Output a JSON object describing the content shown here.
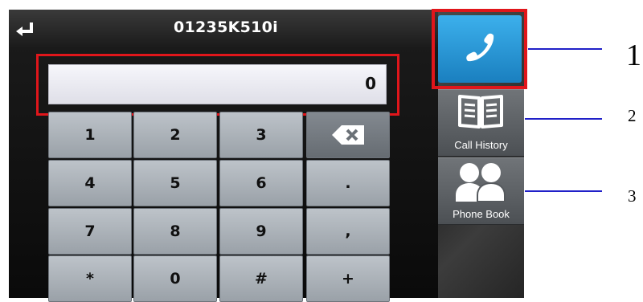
{
  "title": "01235K510i",
  "display": {
    "value": "0"
  },
  "keypad": {
    "rows": [
      [
        "1",
        "2",
        "3",
        ""
      ],
      [
        "4",
        "5",
        "6",
        "."
      ],
      [
        "7",
        "8",
        "9",
        ","
      ],
      [
        "*",
        "0",
        "#",
        "+"
      ]
    ]
  },
  "sidebar": {
    "call_history_label": "Call History",
    "phone_book_label": "Phone Book"
  },
  "callouts": [
    "1",
    "2",
    "3"
  ],
  "colors": {
    "call_button": "#2a97d6",
    "highlight_frame": "#e0161b",
    "callout_line": "#2020c8"
  }
}
